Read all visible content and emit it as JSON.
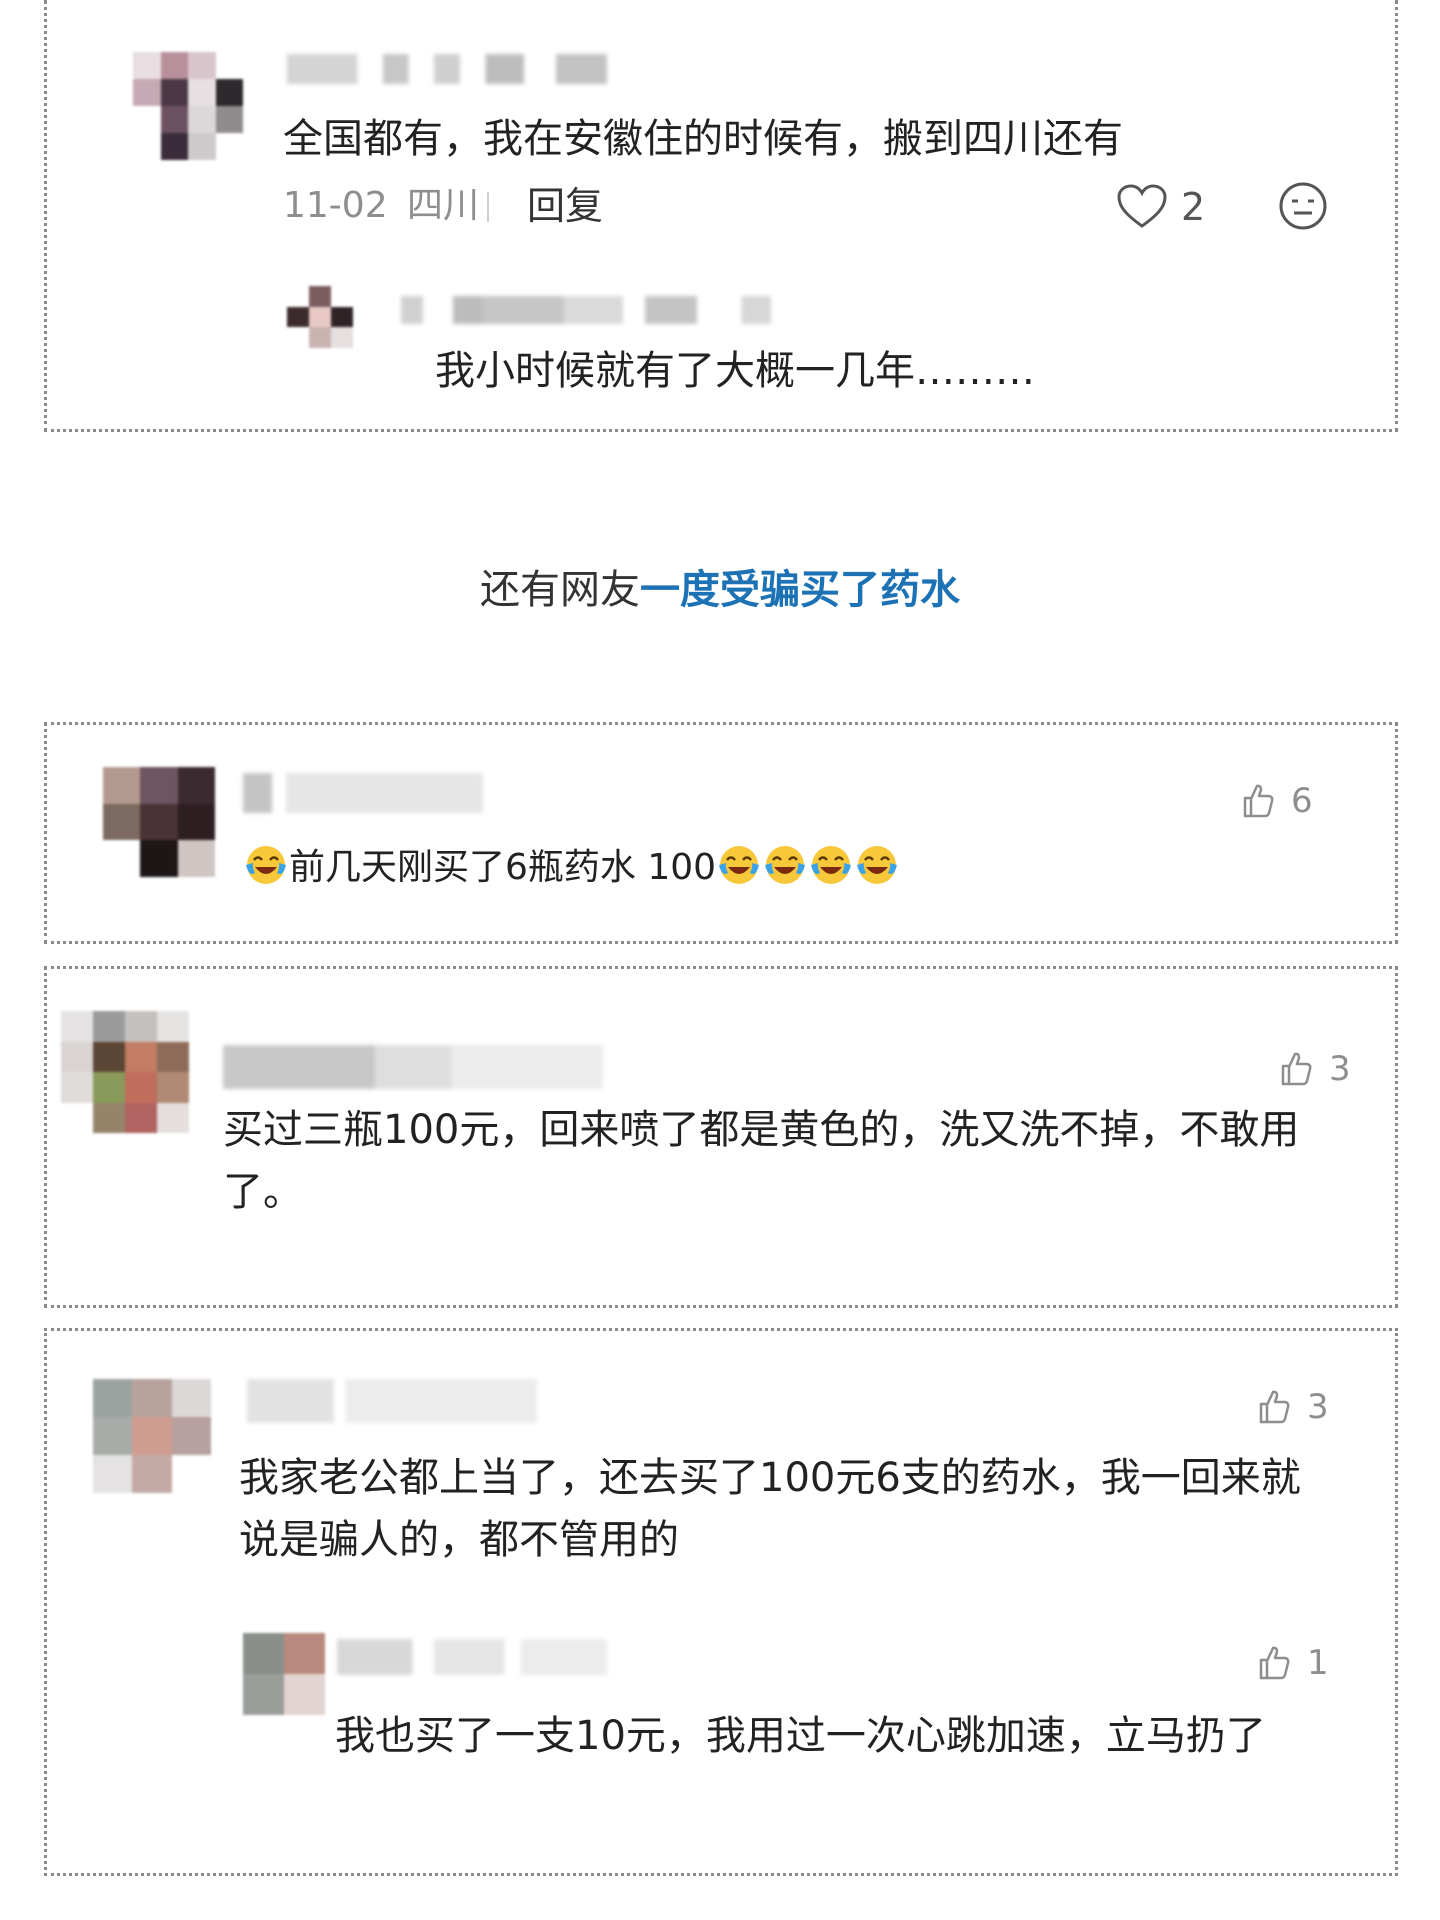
{
  "thread1": {
    "comment": {
      "text": "全国都有，我在安徽住的时候有，搬到四川还有",
      "date": "11-02",
      "location": "四川",
      "reply_label": "回复",
      "likes": "2"
    },
    "reply": {
      "text": "我小时候就有了大概一几年………"
    }
  },
  "headline": {
    "prefix": "还有网友",
    "highlight": "一度受骗买了药水"
  },
  "comments": [
    {
      "text_before": "前几天刚买了6瓶药水 100",
      "likes": "6"
    },
    {
      "text": "买过三瓶100元，回来喷了都是黄色的，洗又洗不掉，不敢用了。",
      "likes": "3"
    },
    {
      "text": "我家老公都上当了，还去买了100元6支的药水，我一回来就说是骗人的，都不管用的",
      "likes": "3"
    }
  ],
  "nested_reply": {
    "text": "我也买了一支10元，我用过一次心跳加速，立马扔了",
    "likes": "1"
  },
  "colors": {
    "highlight": "#1c72b5",
    "border": "#8a8a8a",
    "meta": "#8e8e8e"
  },
  "icons": [
    "heart-icon",
    "emoji-reaction-icon",
    "thumbs-up-icon",
    "laugh-cry-emoji"
  ]
}
